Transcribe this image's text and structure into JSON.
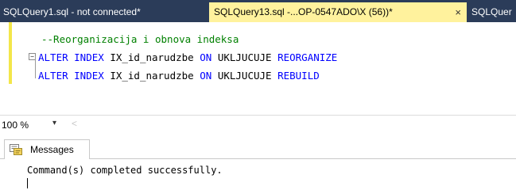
{
  "tabs": [
    {
      "label": "SQLQuery1.sql - not connected*",
      "active": false
    },
    {
      "label": "SQLQuery13.sql -...OP-0547ADO\\X (56))*",
      "active": true,
      "close_glyph": "×"
    },
    {
      "label": "SQLQuer",
      "active": false
    }
  ],
  "editor": {
    "comment": "--Reorganizacija i obnova indeksa",
    "line2": {
      "kw1": "ALTER INDEX",
      "id1": "IX_id_narudzbe",
      "kw2": "ON",
      "id2": "UKLJUCUJE",
      "kw3": "REORGANIZE"
    },
    "line3": {
      "kw1": "ALTER INDEX",
      "id1": "IX_id_narudzbe",
      "kw2": "ON",
      "id2": "UKLJUCUJE",
      "kw3": "REBUILD"
    },
    "fold_glyph": "−"
  },
  "zoom": {
    "value": "100 %",
    "arrow": "▾",
    "scroll_left": "<"
  },
  "results": {
    "tab_label": "Messages",
    "message": "Command(s) completed successfully."
  },
  "colors": {
    "tab_strip": "#2b3c59",
    "active_tab": "#fff29d",
    "keyword": "#0000ff",
    "comment": "#008000",
    "change_bar": "#f3e64a"
  }
}
